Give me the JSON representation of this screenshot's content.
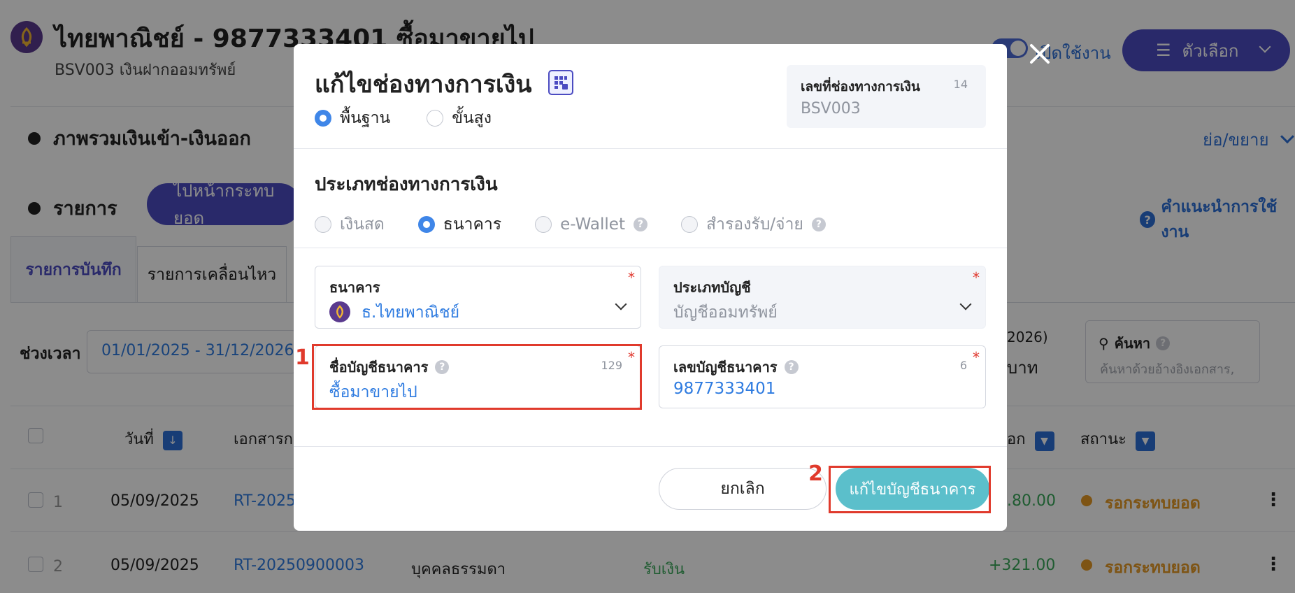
{
  "header": {
    "title": "ไทยพาณิชย์ - 9877333401 ซื้อมาขายไป",
    "subtitle": "BSV003 เงินฝากออมทรัพย์",
    "toggle_label": "เปิดใช้งาน",
    "options_label": "ตัวเลือก"
  },
  "sections": {
    "overview_title": "ภาพรวมเงินเข้า-เงินออก",
    "collapse_label": "ย่อ/ขยาย",
    "list_title": "รายการ",
    "goto_button": "ไปหน้ากระทบยอด",
    "help_link": "คำแนะนำการใช้งาน"
  },
  "tabs": [
    {
      "label": "รายการบันทึก",
      "active": true
    },
    {
      "label": "รายการเคลื่อนไหว",
      "active": false
    }
  ],
  "filters": {
    "period_label": "ช่วงเวลา",
    "period_value": "01/01/2025 - 31/12/2026",
    "summary_partial": "2026)",
    "summary_unit": "บาท",
    "search_label": "ค้นหา",
    "search_placeholder": "ค้นหาด้วยอ้างอิงเอกสาร,"
  },
  "table": {
    "headers": {
      "date": "วันที่",
      "doc": "เอกสารก",
      "amount_partial": "อก",
      "status": "สถานะ"
    },
    "rows": [
      {
        "index": "1",
        "date": "05/09/2025",
        "doc": "RT-2025",
        "party": "",
        "type": "",
        "amount": ".80.00",
        "status": "รอกระทบยอด"
      },
      {
        "index": "2",
        "date": "05/09/2025",
        "doc": "RT-20250900003",
        "party": "บุคคลธรรมดา",
        "type": "รับเงิน",
        "amount": "+321.00",
        "status": "รอกระทบยอด"
      }
    ]
  },
  "modal": {
    "title": "แก้ไขช่องทางการเงิน",
    "mode_options": [
      {
        "label": "พื้นฐาน",
        "selected": true
      },
      {
        "label": "ขั้นสูง",
        "selected": false
      }
    ],
    "channel_no": {
      "label": "เลขที่ช่องทางการเงิน",
      "count": "14",
      "value": "BSV003"
    },
    "type_section_title": "ประเภทช่องทางการเงิน",
    "type_options": [
      {
        "label": "เงินสด",
        "selected": false
      },
      {
        "label": "ธนาคาร",
        "selected": true
      },
      {
        "label": "e-Wallet",
        "selected": false
      },
      {
        "label": "สำรองรับ/จ่าย",
        "selected": false
      }
    ],
    "bank": {
      "label": "ธนาคาร",
      "value": "ธ.ไทยพาณิชย์"
    },
    "account_type": {
      "label": "ประเภทบัญชี",
      "value": "บัญชีออมทรัพย์"
    },
    "account_name": {
      "label": "ชื่อบัญชีธนาคาร",
      "count": "129",
      "value": "ซื้อมาขายไป"
    },
    "account_no": {
      "label": "เลขบัญชีธนาคาร",
      "count": "6",
      "value": "9877333401"
    },
    "cancel_label": "ยกเลิก",
    "submit_label": "แก้ไขบัญชีธนาคาร",
    "required_mark": "*",
    "help_mark": "?"
  },
  "annotations": [
    "1",
    "2"
  ],
  "colors": {
    "brand_purple": "#4b4bc1",
    "bank_logo": "#5a3a8e",
    "link_blue": "#2e7be0",
    "submit_teal": "#5bbfcb",
    "highlight_red": "#e03a2c",
    "status_orange": "#e59a25",
    "positive_green": "#3aa85a"
  }
}
